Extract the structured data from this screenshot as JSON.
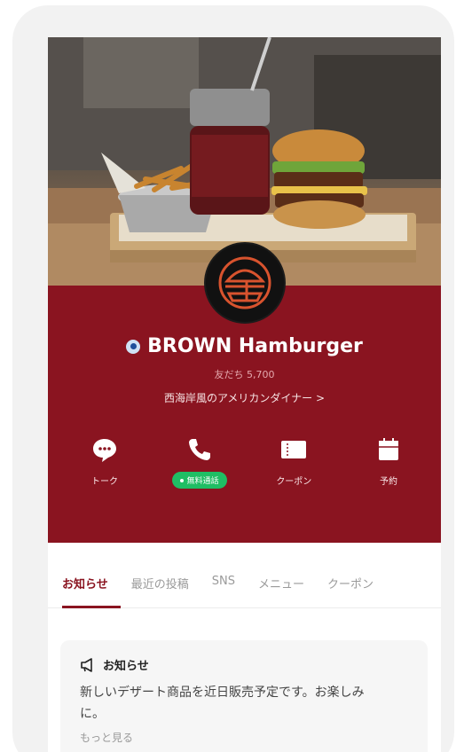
{
  "profile": {
    "name": "BROWN Hamburger",
    "friends": "友だち 5,700",
    "description": "西海岸風のアメリカンダイナー >"
  },
  "actions": [
    {
      "label": "トーク",
      "icon": "chat-icon"
    },
    {
      "label": "",
      "icon": "phone-icon",
      "badge": "無料通話"
    },
    {
      "label": "クーポン",
      "icon": "coupon-icon"
    },
    {
      "label": "予約",
      "icon": "calendar-icon"
    }
  ],
  "tabs": [
    "お知らせ",
    "最近の投稿",
    "SNS",
    "メニュー",
    "クーポン"
  ],
  "notice": {
    "title": "お知らせ",
    "body": "新しいデザート商品を近日販売予定です。お楽しみに。",
    "more": "もっと見る"
  },
  "colors": {
    "brand": "#8a1420",
    "free_call": "#1fbe64"
  }
}
